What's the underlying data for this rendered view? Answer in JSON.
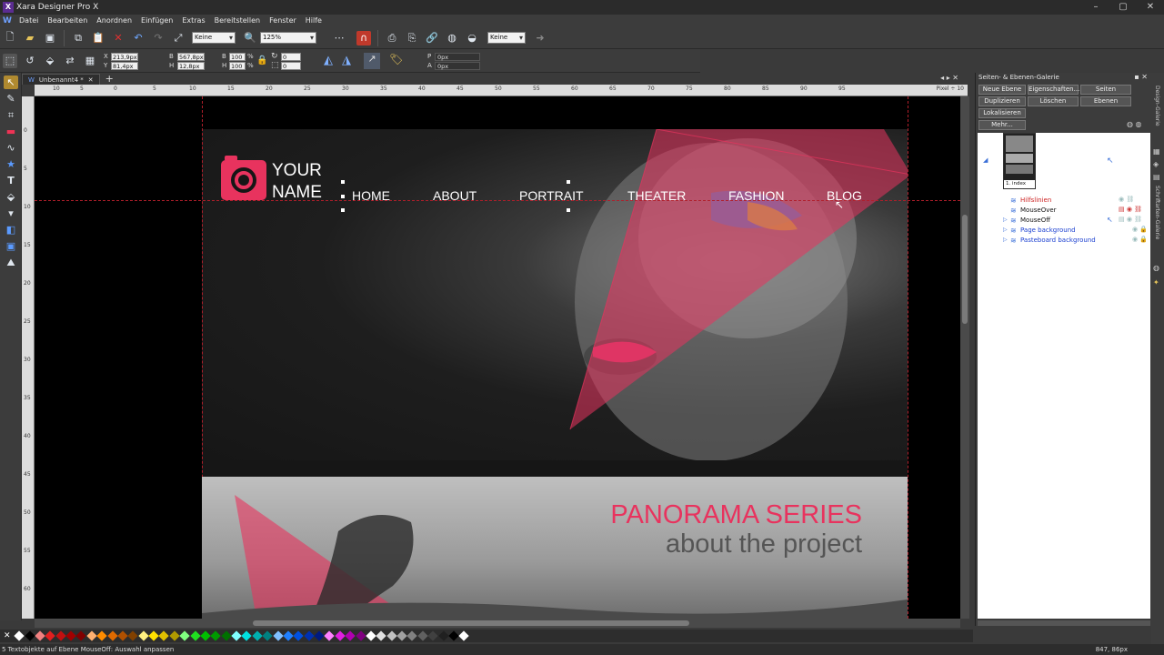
{
  "window": {
    "title": "Xara Designer Pro X"
  },
  "menu": [
    "Datei",
    "Bearbeiten",
    "Anordnen",
    "Einfügen",
    "Extras",
    "Bereitstellen",
    "Fenster",
    "Hilfe"
  ],
  "toolbar1": {
    "feather_value": "Keine",
    "zoom_value": "125%",
    "blend_value": "Keine"
  },
  "toolbar2": {
    "x_label": "X",
    "x_value": "213,9px",
    "y_label": "Y",
    "y_value": "81,4px",
    "w_label": "B",
    "w_value": "567,8px",
    "h_label": "H",
    "h_value": "12,8px",
    "scale_w": "100",
    "scale_h": "100",
    "pct": "%",
    "rot_value": "0",
    "skew_value": "0",
    "p_label": "P",
    "p_value": "0px",
    "a_label": "A",
    "a_value": "0px"
  },
  "document": {
    "tab_title": "Unbenannt4 *",
    "ruler_unit": "Pixel ÷ 10",
    "hruler_ticks": [
      "10",
      "5",
      "0",
      "5",
      "10",
      "15",
      "20",
      "25",
      "30",
      "35",
      "40",
      "45",
      "50",
      "55",
      "60",
      "65",
      "70",
      "75",
      "80",
      "85",
      "90",
      "95"
    ],
    "vruler_ticks": [
      "0",
      "5",
      "10",
      "15",
      "20",
      "25",
      "30",
      "35",
      "40",
      "45",
      "50",
      "55",
      "60",
      "65"
    ]
  },
  "website": {
    "brand_line1": "YOUR",
    "brand_line2": "NAME",
    "nav": [
      "HOME",
      "ABOUT",
      "PORTRAIT",
      "THEATER",
      "FASHION",
      "BLOG"
    ],
    "panorama_title": "PANORAMA SERIES",
    "panorama_subtitle": "about the project",
    "colors": {
      "accent": "#e8335e",
      "nav_text": "#ffffff",
      "subtitle": "#555555"
    }
  },
  "gallery": {
    "title": "Seiten- & Ebenen-Galerie",
    "buttons": {
      "new_layer": "Neue Ebene",
      "properties": "Eigenschaften...",
      "pages": "Seiten",
      "duplicate": "Duplizieren",
      "delete": "Löschen",
      "layers": "Ebenen",
      "localize": "Lokalisieren",
      "more": "Mehr..."
    },
    "page_thumb_label": "1. index",
    "layers": [
      {
        "name": "Hilfslinien",
        "color": "#cc2222"
      },
      {
        "name": "MouseOver",
        "color": "#111111"
      },
      {
        "name": "MouseOff",
        "color": "#111111"
      },
      {
        "name": "Page background",
        "color": "#1a3fd0"
      },
      {
        "name": "Pasteboard background",
        "color": "#1a3fd0"
      }
    ]
  },
  "side_tabs": [
    "Design-Galerie",
    "Schriftarten-Galerie"
  ],
  "palette_colors": [
    "#ffffff",
    "#000000",
    "#f08080",
    "#e02020",
    "#c01010",
    "#a00000",
    "#800000",
    "#ffb070",
    "#ff8c00",
    "#e06a00",
    "#b05000",
    "#804000",
    "#fff080",
    "#ffe000",
    "#e0c000",
    "#b09a00",
    "#80ff80",
    "#20e020",
    "#00c000",
    "#009a00",
    "#007000",
    "#80ffff",
    "#00e0e0",
    "#00b0b0",
    "#008080",
    "#80c0ff",
    "#2080ff",
    "#0050e0",
    "#0030b0",
    "#001a80",
    "#ff80ff",
    "#e020e0",
    "#b000b0",
    "#800080",
    "#ffffff",
    "#e0e0e0",
    "#c0c0c0",
    "#a0a0a0",
    "#808080",
    "#606060",
    "#404040",
    "#202020",
    "#000000",
    "#ffffff"
  ],
  "status": {
    "message": "5 Textobjekte auf Ebene MouseOff: Auswahl anpassen",
    "coords": "847, 86px"
  }
}
